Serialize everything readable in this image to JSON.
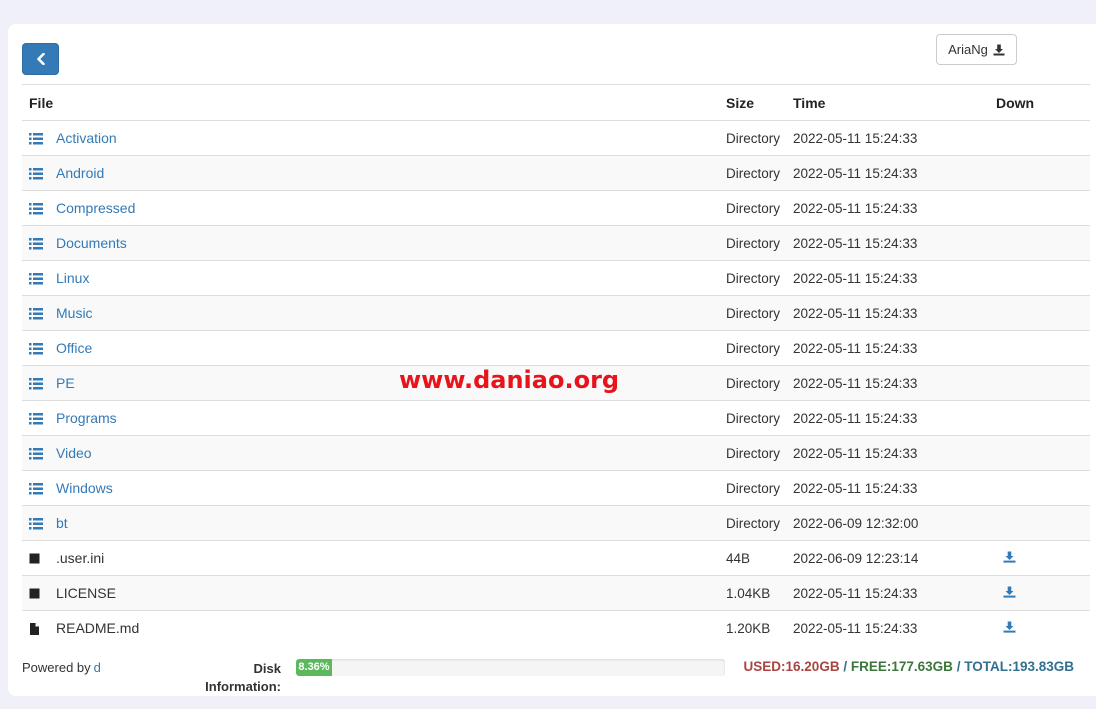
{
  "toolbar": {
    "back_icon": "chevron-left-icon",
    "aria_label": "AriaNg",
    "aria_icon": "download-icon"
  },
  "table": {
    "headers": [
      "File",
      "Size",
      "Time",
      "Down"
    ],
    "rows": [
      {
        "name": "Activation",
        "size": "Directory",
        "time": "2022-05-11 15:24:33",
        "type": "dir",
        "icon": "list-icon"
      },
      {
        "name": "Android",
        "size": "Directory",
        "time": "2022-05-11 15:24:33",
        "type": "dir",
        "icon": "list-icon"
      },
      {
        "name": "Compressed",
        "size": "Directory",
        "time": "2022-05-11 15:24:33",
        "type": "dir",
        "icon": "list-icon"
      },
      {
        "name": "Documents",
        "size": "Directory",
        "time": "2022-05-11 15:24:33",
        "type": "dir",
        "icon": "list-icon"
      },
      {
        "name": "Linux",
        "size": "Directory",
        "time": "2022-05-11 15:24:33",
        "type": "dir",
        "icon": "list-icon"
      },
      {
        "name": "Music",
        "size": "Directory",
        "time": "2022-05-11 15:24:33",
        "type": "dir",
        "icon": "list-icon"
      },
      {
        "name": "Office",
        "size": "Directory",
        "time": "2022-05-11 15:24:33",
        "type": "dir",
        "icon": "list-icon"
      },
      {
        "name": "PE",
        "size": "Directory",
        "time": "2022-05-11 15:24:33",
        "type": "dir",
        "icon": "list-icon"
      },
      {
        "name": "Programs",
        "size": "Directory",
        "time": "2022-05-11 15:24:33",
        "type": "dir",
        "icon": "list-icon"
      },
      {
        "name": "Video",
        "size": "Directory",
        "time": "2022-05-11 15:24:33",
        "type": "dir",
        "icon": "list-icon"
      },
      {
        "name": "Windows",
        "size": "Directory",
        "time": "2022-05-11 15:24:33",
        "type": "dir",
        "icon": "list-icon"
      },
      {
        "name": "bt",
        "size": "Directory",
        "time": "2022-06-09 12:32:00",
        "type": "dir",
        "icon": "list-icon"
      },
      {
        "name": ".user.ini",
        "size": "44B",
        "time": "2022-06-09 12:23:14",
        "type": "file",
        "icon": "square-icon"
      },
      {
        "name": "LICENSE",
        "size": "1.04KB",
        "time": "2022-05-11 15:24:33",
        "type": "file",
        "icon": "square-icon"
      },
      {
        "name": "README.md",
        "size": "1.20KB",
        "time": "2022-05-11 15:24:33",
        "type": "file",
        "icon": "file-icon"
      }
    ]
  },
  "watermark": "www.daniao.org",
  "footer": {
    "powered_label": "Powered by",
    "powered_link": "d",
    "disk_label_line1": "Disk",
    "disk_label_line2": "Information:",
    "disk_percent_label": "8.36%",
    "disk_percent_value": 8.36,
    "used": "USED:16.20GB",
    "free": "FREE:177.63GB",
    "total": "TOTAL:193.83GB",
    "separator": "/"
  },
  "colors": {
    "link": "#337ab7",
    "primary_button": "#337ab7",
    "progress": "#5cb85c",
    "used": "#a94442",
    "free": "#3c763d",
    "total": "#31708f",
    "watermark": "#e8141c"
  }
}
